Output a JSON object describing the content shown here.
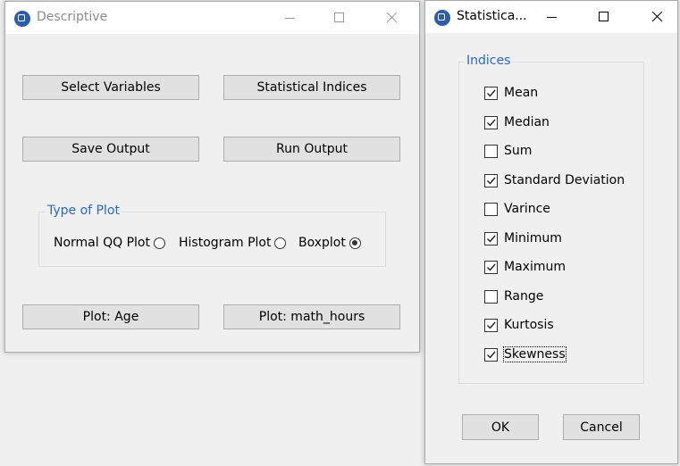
{
  "descriptive": {
    "title": "Descriptive",
    "buttons": {
      "select_variables": "Select Variables",
      "statistical_indices": "Statistical Indices",
      "save_output": "Save Output",
      "run_output": "Run Output",
      "plot_age": "Plot: Age",
      "plot_math_hours": "Plot: math_hours"
    },
    "plot_type": {
      "label": "Type of Plot",
      "options": [
        {
          "label": "Normal QQ Plot",
          "selected": false
        },
        {
          "label": "Histogram Plot",
          "selected": false
        },
        {
          "label": "Boxplot",
          "selected": true
        }
      ]
    }
  },
  "statistics": {
    "title": "Statistica...",
    "group_label": "Indices",
    "indices": [
      {
        "label": "Mean",
        "checked": true
      },
      {
        "label": "Median",
        "checked": true
      },
      {
        "label": "Sum",
        "checked": false
      },
      {
        "label": "Standard Deviation",
        "checked": true
      },
      {
        "label": "Varince",
        "checked": false
      },
      {
        "label": "Minimum",
        "checked": true
      },
      {
        "label": "Maximum",
        "checked": true
      },
      {
        "label": "Range",
        "checked": false
      },
      {
        "label": "Kurtosis",
        "checked": true
      },
      {
        "label": "Skewness",
        "checked": true
      }
    ],
    "ok_label": "OK",
    "cancel_label": "Cancel"
  },
  "colors": {
    "accent_label": "#2867c6",
    "app_icon": "#2d5ca8",
    "window_bg": "#f0f0f0",
    "button_bg": "#e1e1e1"
  }
}
